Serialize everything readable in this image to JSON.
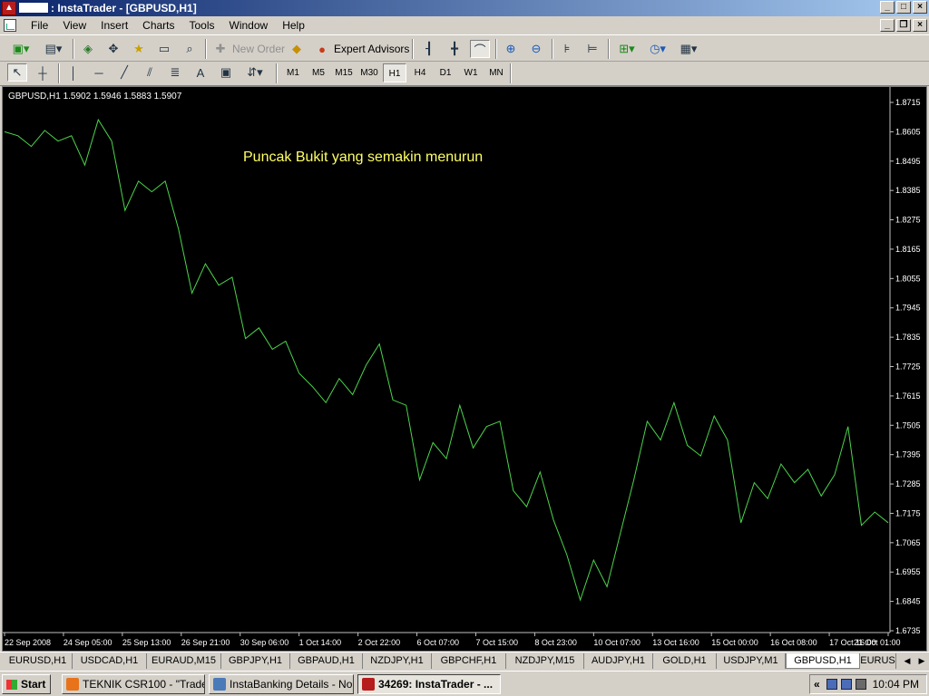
{
  "window": {
    "title": ": InstaTrader - [GBPUSD,H1]",
    "account_box": ""
  },
  "menu": [
    "File",
    "View",
    "Insert",
    "Charts",
    "Tools",
    "Window",
    "Help"
  ],
  "toolbar": {
    "new_order_label": "New Order",
    "expert_advisors_label": "Expert Advisors"
  },
  "timeframes": [
    "M1",
    "M5",
    "M15",
    "M30",
    "H1",
    "H4",
    "D1",
    "W1",
    "MN"
  ],
  "active_timeframe": "H1",
  "chart": {
    "info_label": "GBPUSD,H1  1.5902 1.5946 1.5883 1.5907",
    "annotation": "Puncak Bukit yang semakin menurun",
    "annotation_color": "#ffff66",
    "line_color": "#4cd44c",
    "background": "#000000"
  },
  "chart_data": {
    "type": "line",
    "series": [
      {
        "values": [
          1.8605,
          1.859,
          1.855,
          1.861,
          1.857,
          1.859,
          1.848,
          1.865,
          1.857,
          1.831,
          1.842,
          1.838,
          1.842,
          1.824,
          1.8,
          1.811,
          1.803,
          1.806,
          1.783,
          1.787,
          1.779,
          1.782,
          1.77,
          1.765,
          1.759,
          1.768,
          1.762,
          1.773,
          1.781,
          1.76,
          1.758,
          1.73,
          1.744,
          1.738,
          1.758,
          1.742,
          1.75,
          1.752,
          1.726,
          1.72,
          1.733,
          1.715,
          1.702,
          1.685,
          1.7,
          1.69,
          1.71,
          1.73,
          1.752,
          1.745,
          1.759,
          1.743,
          1.739,
          1.754,
          1.745,
          1.714,
          1.729,
          1.723,
          1.736,
          1.729,
          1.734,
          1.724,
          1.732,
          1.75,
          1.713,
          1.718,
          1.714
        ]
      }
    ],
    "y_ticks": [
      "1.8715",
      "1.8605",
      "1.8495",
      "1.8385",
      "1.8275",
      "1.8165",
      "1.8055",
      "1.7945",
      "1.7835",
      "1.7725",
      "1.7615",
      "1.7505",
      "1.7395",
      "1.7285",
      "1.7175",
      "1.7065",
      "1.6955",
      "1.6845",
      "1.6735"
    ],
    "x_ticks": [
      "22 Sep 2008",
      "24 Sep 05:00",
      "25 Sep 13:00",
      "26 Sep 21:00",
      "30 Sep 06:00",
      "1 Oct 14:00",
      "2 Oct 22:00",
      "6 Oct 07:00",
      "7 Oct 15:00",
      "8 Oct 23:00",
      "10 Oct 07:00",
      "13 Oct 16:00",
      "15 Oct 00:00",
      "16 Oct 08:00",
      "17 Oct 16:00",
      "21 Oct 01:00"
    ],
    "ylim": [
      1.6735,
      1.8715
    ],
    "grid": false
  },
  "chart_tabs": [
    "EURUSD,H1",
    "USDCAD,H1",
    "EURAUD,M15",
    "GBPJPY,H1",
    "GBPAUD,H1",
    "NZDJPY,H1",
    "GBPCHF,H1",
    "NZDJPY,M15",
    "AUDJPY,H1",
    "GOLD,H1",
    "USDJPY,M1",
    "GBPUSD,H1",
    "EURUS"
  ],
  "active_tab": "GBPUSD,H1",
  "taskbar": {
    "start_label": "Start",
    "items": [
      "TEKNIK CSR100 - \"Trade...",
      "InstaBanking Details - No...",
      "34269: InstaTrader - ..."
    ],
    "clock": "10:04 PM",
    "tray_chevron": "«"
  }
}
